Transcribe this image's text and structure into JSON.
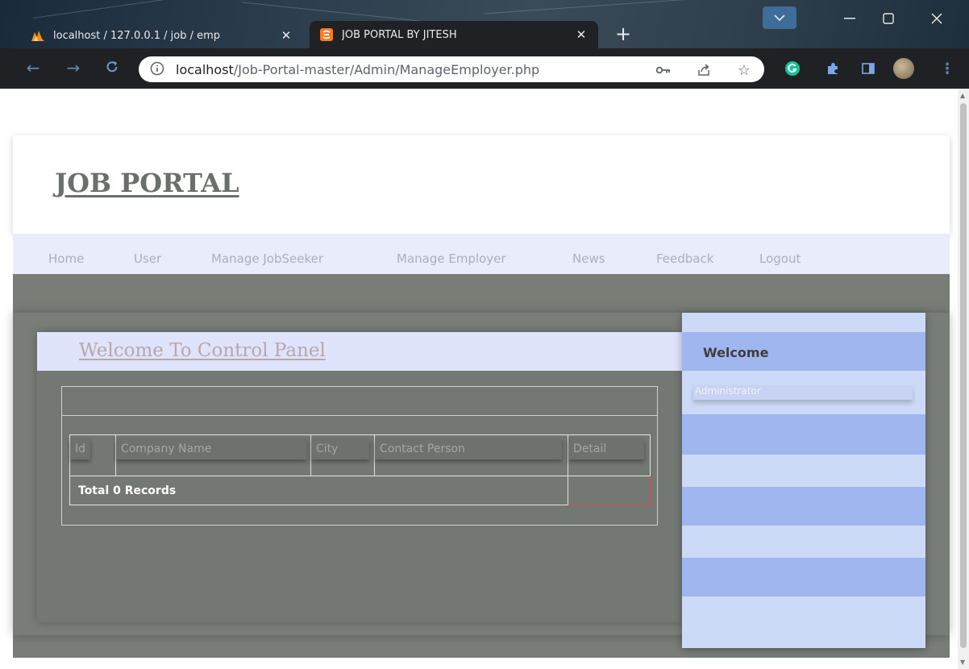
{
  "browser": {
    "tabs": [
      {
        "title": "localhost / 127.0.0.1 / job / emp",
        "active": false,
        "favicon": "phpmyadmin-icon"
      },
      {
        "title": "JOB PORTAL BY JITESH",
        "active": true,
        "favicon": "xampp-icon"
      }
    ],
    "url_host": "localhost",
    "url_path": "/Job-Portal-master/Admin/ManageEmployer.php"
  },
  "header": {
    "site_title": "JOB PORTAL"
  },
  "menu": {
    "items": [
      "Home",
      "User",
      "Manage JobSeeker",
      "Manage Employer",
      "News",
      "Feedback",
      "Logout"
    ]
  },
  "main": {
    "panel_title": "Welcome To Control Panel",
    "table": {
      "columns": [
        "Id",
        "Company Name",
        "City",
        "Contact Person",
        "Detail"
      ],
      "rows": [],
      "total_text": "Total 0 Records"
    }
  },
  "sidebar": {
    "heading": "Welcome",
    "user": "Administrator"
  },
  "colors": {
    "content_bg": "#787d78",
    "menu_bg": "#e8ecfb",
    "sidebar_dark": "#9fb6ee",
    "sidebar_light": "#ccdaf7",
    "detail_border": "#d45050"
  }
}
